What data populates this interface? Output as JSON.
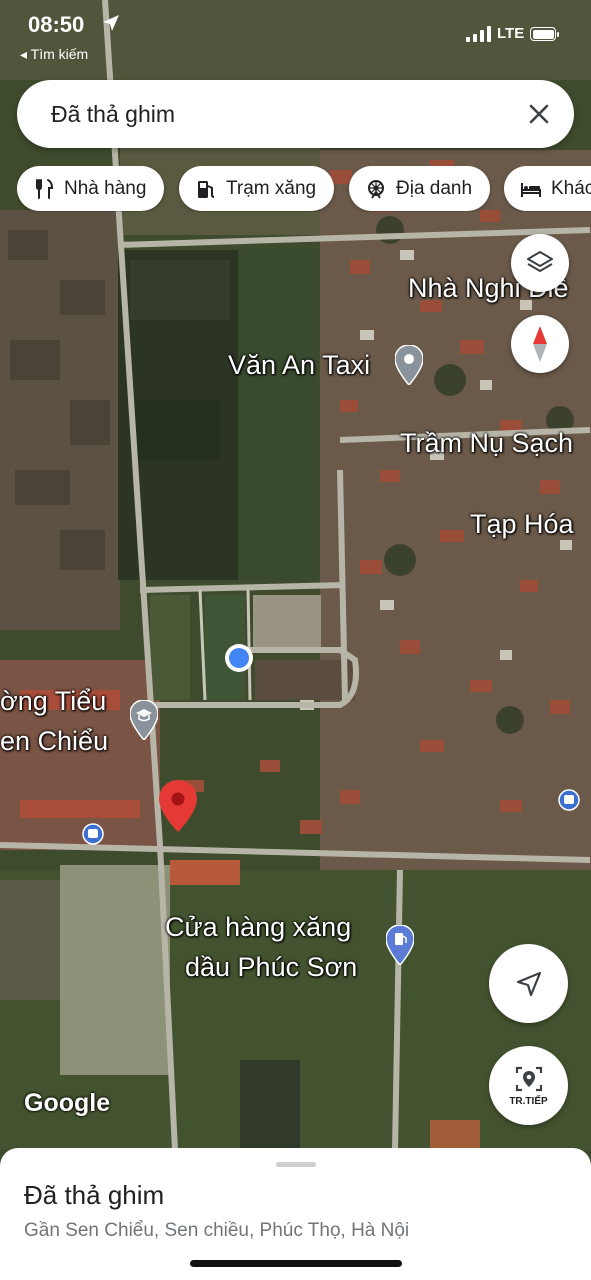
{
  "status_bar": {
    "time": "08:50",
    "back_app": "◂ Tìm kiếm",
    "network": "LTE"
  },
  "search": {
    "value": "Đã thả ghim"
  },
  "chips": [
    {
      "label": "Nhà hàng",
      "icon": "restaurant-icon"
    },
    {
      "label": "Trạm xăng",
      "icon": "gas-station-icon"
    },
    {
      "label": "Địa danh",
      "icon": "landmark-icon"
    },
    {
      "label": "Khác",
      "icon": "bed-icon"
    }
  ],
  "map_labels": {
    "nha_nghi": "Nhà Nghỉ Điề",
    "van_an_taxi": "Văn An Taxi",
    "tram_nu": "Trầm Nụ Sạch",
    "tap_hoa": "Tạp Hóa",
    "truong_tieu_1": "ờng Tiểu",
    "truong_tieu_2": "en Chiểu",
    "cua_hang_1": "Cửa hàng xăng",
    "cua_hang_2": "dầu Phúc Sơn"
  },
  "live_view": {
    "label": "TR.TIẾP"
  },
  "google_logo": "Google",
  "bottom_sheet": {
    "title": "Đã thả ghim",
    "subtitle": "Gần Sen Chiểu, Sen chiều, Phúc Thọ, Hà Nội"
  },
  "colors": {
    "pin_red": "#e53935",
    "location_blue": "#4285f4",
    "poi_gray": "#8a939b",
    "compass_red": "#e53935"
  }
}
